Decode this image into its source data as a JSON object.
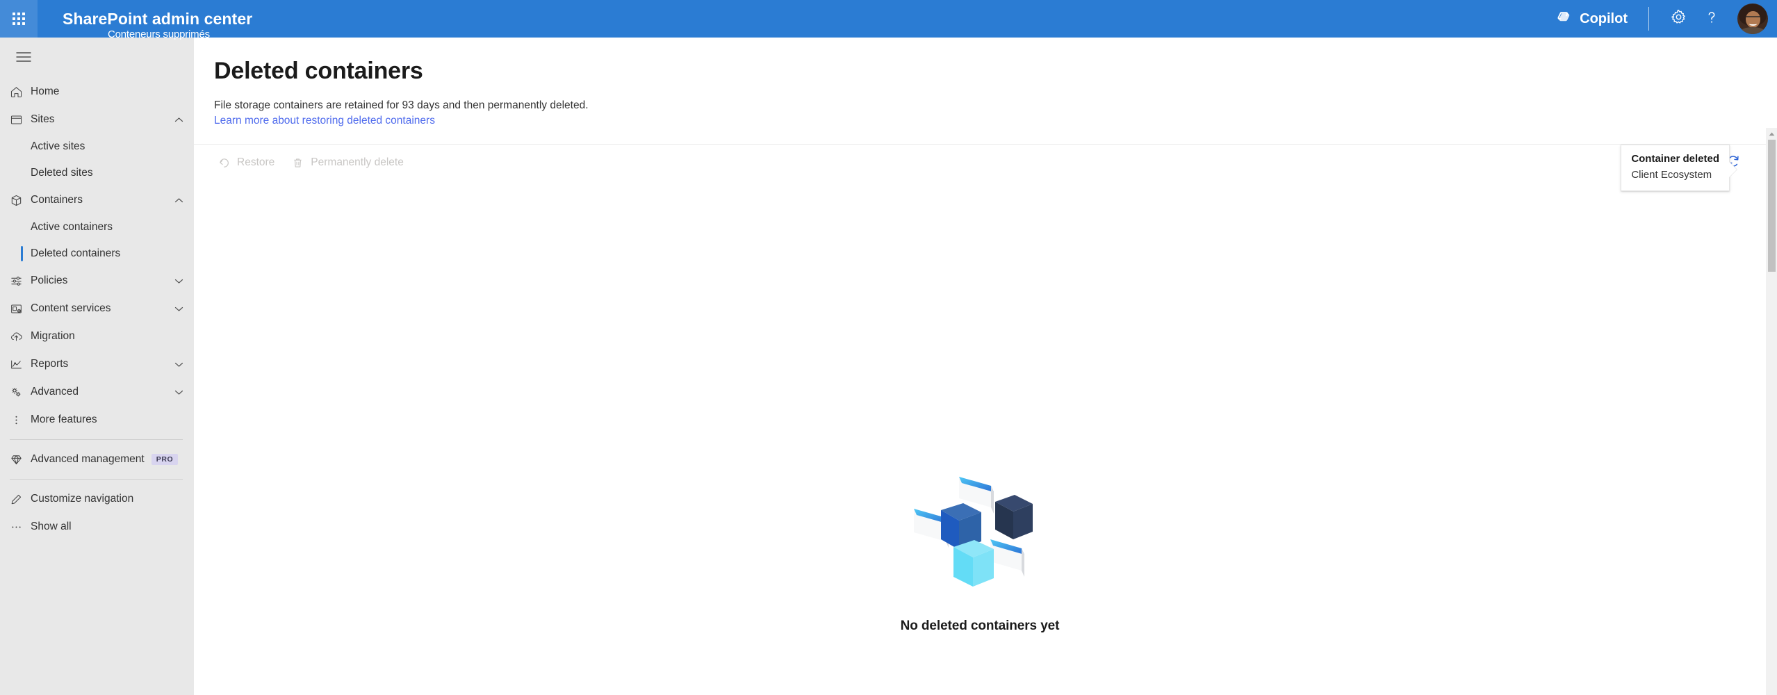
{
  "suite": {
    "app_launcher": "app-launcher",
    "title": "SharePoint admin center",
    "copilot_label": "Copilot",
    "settings_label": "Settings",
    "help_label": "Help",
    "account_label": "Account manager",
    "overlay_text": "Conteneurs supprimés",
    "brand_color": "#2b7cd3"
  },
  "sidebar": {
    "toggle_label": "Global navigation",
    "items": [
      {
        "id": "home",
        "label": "Home",
        "icon": "home-icon",
        "type": "item",
        "expandable": false
      },
      {
        "id": "sites",
        "label": "Sites",
        "icon": "sites-icon",
        "type": "item",
        "expandable": true,
        "expanded": true
      },
      {
        "id": "active-sites",
        "label": "Active sites",
        "type": "sub",
        "selected": false
      },
      {
        "id": "deleted-sites",
        "label": "Deleted sites",
        "type": "sub",
        "selected": false
      },
      {
        "id": "containers",
        "label": "Containers",
        "icon": "containers-icon",
        "type": "item",
        "expandable": true,
        "expanded": true
      },
      {
        "id": "active-containers",
        "label": "Active containers",
        "type": "sub",
        "selected": false
      },
      {
        "id": "deleted-containers",
        "label": "Deleted containers",
        "type": "sub",
        "selected": true
      },
      {
        "id": "policies",
        "label": "Policies",
        "icon": "policies-icon",
        "type": "item",
        "expandable": true,
        "expanded": false
      },
      {
        "id": "content-services",
        "label": "Content services",
        "icon": "content-services-icon",
        "type": "item",
        "expandable": true,
        "expanded": false
      },
      {
        "id": "migration",
        "label": "Migration",
        "icon": "migration-icon",
        "type": "item",
        "expandable": false
      },
      {
        "id": "reports",
        "label": "Reports",
        "icon": "reports-icon",
        "type": "item",
        "expandable": true,
        "expanded": false
      },
      {
        "id": "advanced",
        "label": "Advanced",
        "icon": "advanced-icon",
        "type": "item",
        "expandable": true,
        "expanded": false
      },
      {
        "id": "more-features",
        "label": "More features",
        "icon": "more-features-icon",
        "type": "item",
        "expandable": false
      }
    ],
    "advanced_management": {
      "label": "Advanced management",
      "icon": "diamond-icon",
      "badge": "PRO"
    },
    "customize_navigation": {
      "label": "Customize navigation",
      "icon": "pencil-icon"
    },
    "show_all": {
      "label": "Show all",
      "icon": "ellipsis-icon"
    }
  },
  "page": {
    "title": "Deleted containers",
    "description": "File storage containers are retained for 93 days and then permanently deleted.",
    "link_text": "Learn more about restoring deleted containers",
    "link_color": "#4f6bed"
  },
  "toolbar": {
    "restore_label": "Restore",
    "restore_icon": "restore-arrow-icon",
    "restore_disabled": true,
    "delete_label": "Permanently delete",
    "delete_icon": "trash-icon",
    "delete_disabled": true,
    "refresh_label": "Refresh",
    "refresh_icon": "refresh-icon"
  },
  "callout": {
    "title": "Container deleted",
    "subtitle": "Client Ecosystem"
  },
  "empty_state": {
    "illustration": "isometric-containers-illustration",
    "text": "No deleted containers yet"
  },
  "scrollbar": {
    "up_arrow": "scroll-up-arrow-icon"
  }
}
